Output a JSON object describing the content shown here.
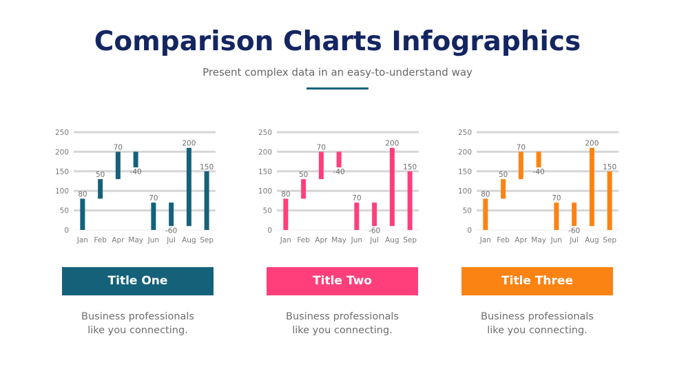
{
  "header": {
    "title": "Comparison Charts Infographics",
    "subtitle": "Present complex data in an easy-to-understand way",
    "accent": "#15617a"
  },
  "panels": [
    {
      "title": "Title One",
      "line1": "Business professionals",
      "line2": "like you connecting.",
      "color": "#15617a"
    },
    {
      "title": "Title Two",
      "line1": "Business professionals",
      "line2": "like you connecting.",
      "color": "#ff3f7c"
    },
    {
      "title": "Title Three",
      "line1": "Business professionals",
      "line2": "like you connecting.",
      "color": "#fb8313"
    }
  ],
  "chart_data": [
    {
      "type": "bar",
      "subtype": "waterfall",
      "categories": [
        "Jan",
        "Feb",
        "Apr",
        "May",
        "Jun",
        "Jul",
        "Aug",
        "Sep"
      ],
      "values": [
        80,
        50,
        70,
        -40,
        70,
        -60,
        200,
        150
      ],
      "bar_ranges": [
        [
          0,
          80
        ],
        [
          80,
          130
        ],
        [
          130,
          200
        ],
        [
          160,
          200
        ],
        [
          0,
          70
        ],
        [
          10,
          70
        ],
        [
          10,
          210
        ],
        [
          0,
          150
        ]
      ],
      "data_labels": [
        "80",
        "50",
        "70",
        "-40",
        "70",
        "-60",
        "200",
        "150"
      ],
      "yticks": [
        0,
        50,
        100,
        150,
        200,
        250
      ],
      "ylim": [
        0,
        250
      ],
      "grid": true,
      "color": "#15617a",
      "title": "",
      "xlabel": "",
      "ylabel": ""
    },
    {
      "type": "bar",
      "subtype": "waterfall",
      "categories": [
        "Jan",
        "Feb",
        "Apr",
        "May",
        "Jun",
        "Jul",
        "Aug",
        "Sep"
      ],
      "values": [
        80,
        50,
        70,
        -40,
        70,
        -60,
        200,
        150
      ],
      "bar_ranges": [
        [
          0,
          80
        ],
        [
          80,
          130
        ],
        [
          130,
          200
        ],
        [
          160,
          200
        ],
        [
          0,
          70
        ],
        [
          10,
          70
        ],
        [
          10,
          210
        ],
        [
          0,
          150
        ]
      ],
      "data_labels": [
        "80",
        "50",
        "70",
        "-40",
        "70",
        "-60",
        "200",
        "150"
      ],
      "yticks": [
        0,
        50,
        100,
        150,
        200,
        250
      ],
      "ylim": [
        0,
        250
      ],
      "grid": true,
      "color": "#ff3f7c",
      "title": "",
      "xlabel": "",
      "ylabel": ""
    },
    {
      "type": "bar",
      "subtype": "waterfall",
      "categories": [
        "Jan",
        "Feb",
        "Apr",
        "May",
        "Jun",
        "Jul",
        "Aug",
        "Sep"
      ],
      "values": [
        80,
        50,
        70,
        -40,
        70,
        -60,
        200,
        150
      ],
      "bar_ranges": [
        [
          0,
          80
        ],
        [
          80,
          130
        ],
        [
          130,
          200
        ],
        [
          160,
          200
        ],
        [
          0,
          70
        ],
        [
          10,
          70
        ],
        [
          10,
          210
        ],
        [
          0,
          150
        ]
      ],
      "data_labels": [
        "80",
        "50",
        "70",
        "-40",
        "70",
        "-60",
        "200",
        "150"
      ],
      "yticks": [
        0,
        50,
        100,
        150,
        200,
        250
      ],
      "ylim": [
        0,
        250
      ],
      "grid": true,
      "color": "#fb8313",
      "title": "",
      "xlabel": "",
      "ylabel": ""
    }
  ]
}
